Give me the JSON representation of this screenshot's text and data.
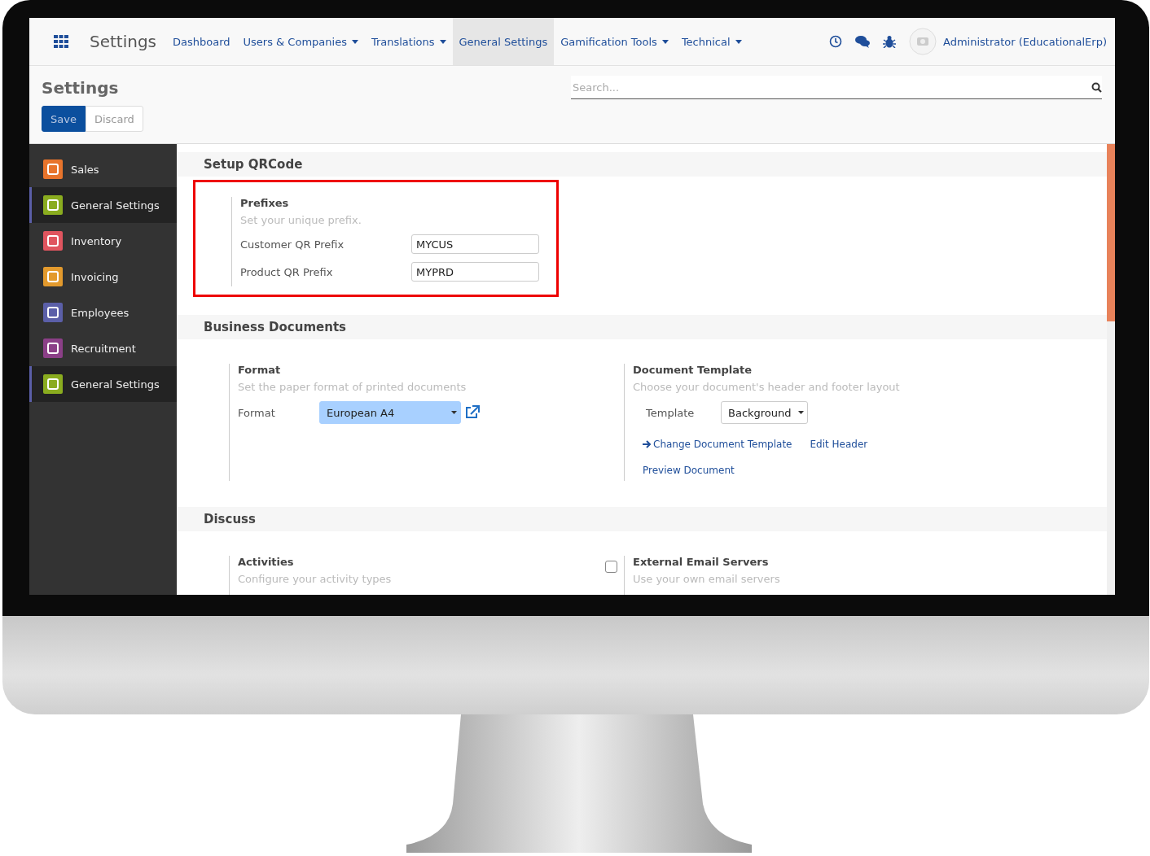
{
  "navbar": {
    "app_title": "Settings",
    "menu": [
      {
        "label": "Dashboard",
        "dropdown": false,
        "selected": false
      },
      {
        "label": "Users & Companies",
        "dropdown": true,
        "selected": false
      },
      {
        "label": "Translations",
        "dropdown": true,
        "selected": false
      },
      {
        "label": "General Settings",
        "dropdown": false,
        "selected": true
      },
      {
        "label": "Gamification Tools",
        "dropdown": true,
        "selected": false
      },
      {
        "label": "Technical",
        "dropdown": true,
        "selected": false
      }
    ],
    "user": "Administrator (EducationalErp)"
  },
  "control_panel": {
    "title": "Settings",
    "search": {
      "placeholder": "Search..."
    },
    "buttons": [
      {
        "label": "Save",
        "kind": "primary"
      },
      {
        "label": "Discard",
        "kind": "secondary"
      }
    ]
  },
  "sidebar": {
    "items": [
      {
        "label": "Sales",
        "color": "#e8742c",
        "selected": false
      },
      {
        "label": "General Settings",
        "color": "#8aac1f",
        "selected": true
      },
      {
        "label": "Inventory",
        "color": "#e0555f",
        "selected": false
      },
      {
        "label": "Invoicing",
        "color": "#e39a2d",
        "selected": false
      },
      {
        "label": "Employees",
        "color": "#5b5fa8",
        "selected": false
      },
      {
        "label": "Recruitment",
        "color": "#8b3f87",
        "selected": false
      },
      {
        "label": "General Settings",
        "color": "#8aac1f",
        "selected": true
      }
    ]
  },
  "sections": [
    {
      "title": "Setup QRCode",
      "highlighted": true,
      "blocks": [
        {
          "title": "Prefixes",
          "description": "Set your unique prefix.",
          "fields": [
            {
              "label": "Customer QR Prefix",
              "value": "MYCUS",
              "kind": "text"
            },
            {
              "label": "Product QR Prefix",
              "value": "MYPRD",
              "kind": "text"
            }
          ]
        }
      ]
    },
    {
      "title": "Business Documents",
      "highlighted": false,
      "blocks": [
        {
          "title": "Format",
          "description": "Set the paper format of printed documents",
          "fields": [
            {
              "label": "Format",
              "value": "European A4",
              "kind": "select",
              "focused": true,
              "external_link": true
            }
          ]
        },
        {
          "title": "Document Template",
          "description": "Choose your document's header and footer layout",
          "fields": [
            {
              "label": "Template",
              "value": "Background",
              "kind": "select",
              "focused": false,
              "external_link": false
            }
          ],
          "link_rows": [
            [
              {
                "label": "Change Document Template",
                "arrow": true
              },
              {
                "label": "Edit Header",
                "arrow": false
              }
            ],
            [
              {
                "label": "Preview Document",
                "arrow": false
              }
            ]
          ]
        }
      ]
    },
    {
      "title": "Discuss",
      "highlighted": false,
      "blocks": [
        {
          "title": "Activities",
          "description": "Configure your activity types"
        },
        {
          "title": "External Email Servers",
          "description": "Use your own email servers",
          "checkbox": {
            "checked": false
          }
        }
      ]
    }
  ]
}
